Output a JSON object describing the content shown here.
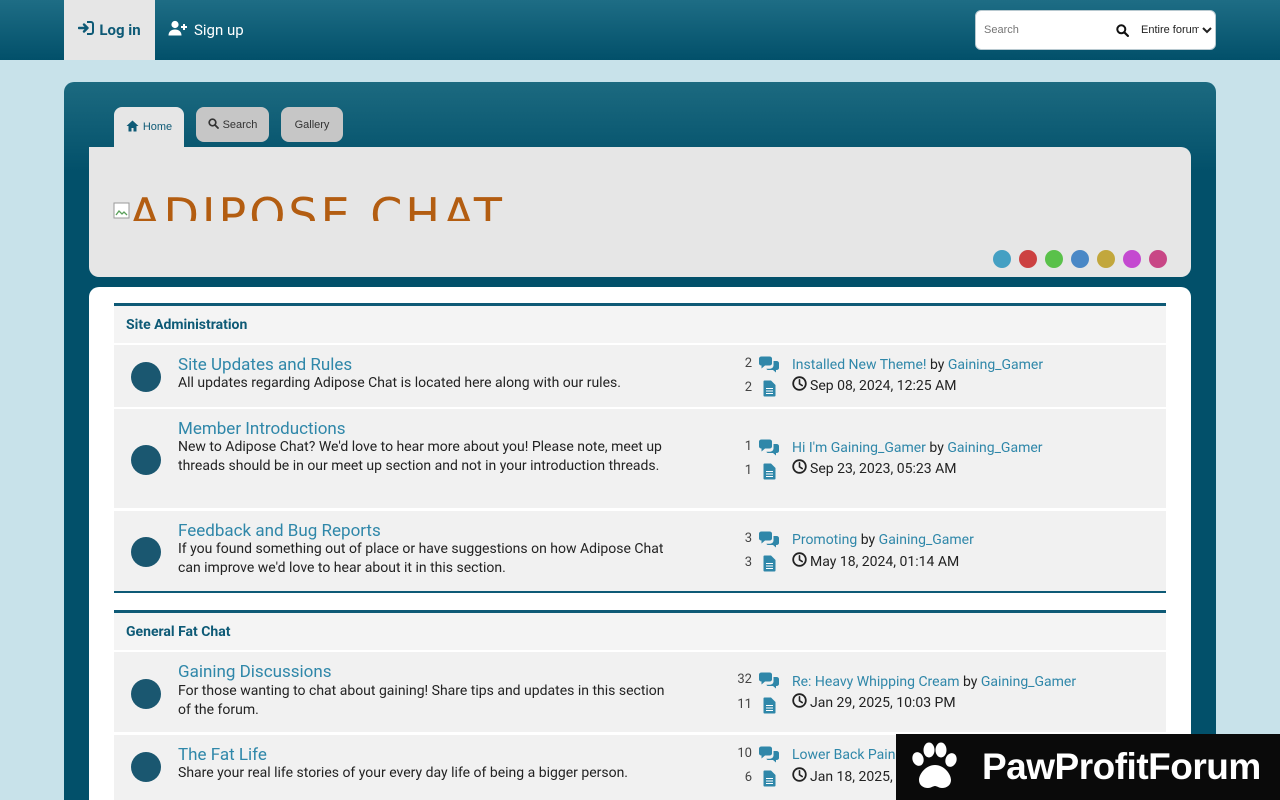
{
  "header": {
    "login_label": "Log in",
    "signup_label": "Sign up",
    "search": {
      "placeholder": "Search",
      "scope": "Entire forum"
    }
  },
  "nav": {
    "tabs": [
      {
        "label": "Home",
        "active": true
      },
      {
        "label": "Search"
      },
      {
        "label": "Gallery"
      }
    ]
  },
  "banner": {
    "logo_text": "ADIPOSE CHAT",
    "theme_colors": [
      "#45a0c3",
      "#cc4141",
      "#5ac14a",
      "#4a88c6",
      "#c2a73c",
      "#c44ad0",
      "#c84786"
    ]
  },
  "categories": [
    {
      "name": "Site Administration",
      "boards": [
        {
          "title": "Site Updates and Rules",
          "description": "All updates regarding Adipose Chat is located here along with our rules.",
          "topics": "2",
          "posts": "2",
          "last_post": {
            "title": "Installed New Theme!",
            "by_word": "by",
            "author": "Gaining_Gamer",
            "date": "Sep 08, 2024, 12:25 AM"
          }
        },
        {
          "title": "Member Introductions",
          "description": "New to Adipose Chat? We'd love to hear more about you! Please note, meet up threads should be in our meet up section and not in your introduction threads.",
          "topics": "1",
          "posts": "1",
          "last_post": {
            "title": "Hi I'm Gaining_Gamer",
            "by_word": "by",
            "author": "Gaining_Gamer",
            "date": "Sep 23, 2023, 05:23 AM"
          }
        },
        {
          "title": "Feedback and Bug Reports",
          "description": "If you found something out of place or have suggestions on how Adipose Chat can improve we'd love to hear about it in this section.",
          "topics": "3",
          "posts": "3",
          "last_post": {
            "title": "Promoting",
            "by_word": "by",
            "author": "Gaining_Gamer",
            "date": "May 18, 2024, 01:14 AM"
          }
        }
      ]
    },
    {
      "name": "General Fat Chat",
      "boards": [
        {
          "title": "Gaining Discussions",
          "description": "For those wanting to chat about gaining! Share tips and updates in this section of the forum.",
          "topics": "32",
          "posts": "11",
          "last_post": {
            "title": "Re: Heavy Whipping Cream",
            "by_word": "by",
            "author": "Gaining_Gamer",
            "date": "Jan 29, 2025, 10:03 PM"
          }
        },
        {
          "title": "The Fat Life",
          "description": "Share your real life stories of your every day life of being a bigger person.",
          "topics": "10",
          "posts": "6",
          "last_post": {
            "title": "Lower Back Pain",
            "by_word": "",
            "author": "",
            "date": "Jan 18, 2025,"
          }
        }
      ]
    }
  ],
  "watermark": {
    "text": "PawProfitForum"
  }
}
